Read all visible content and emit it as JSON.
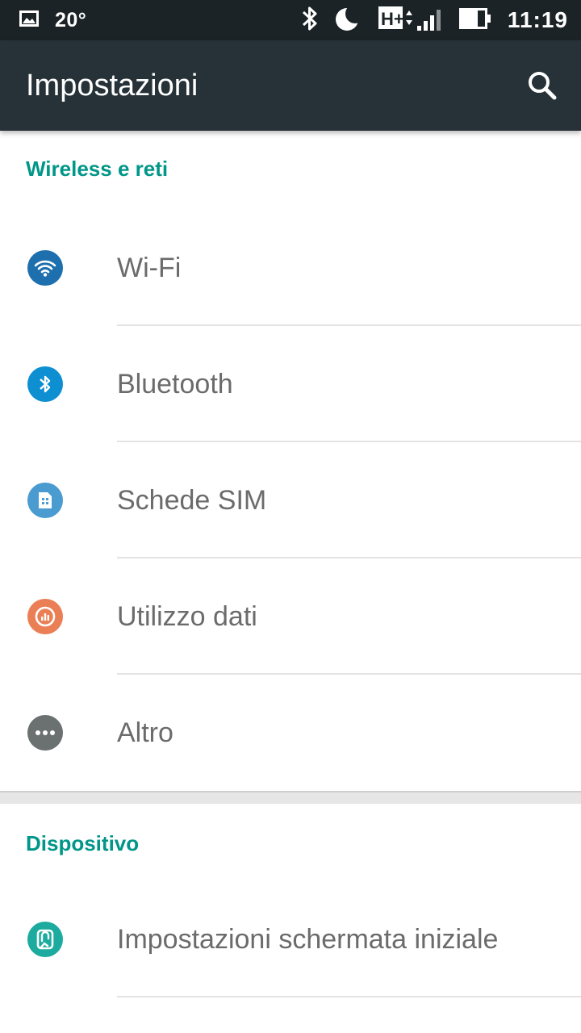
{
  "status_bar": {
    "temperature": "20°",
    "time": "11:19",
    "network_type": "H+",
    "icons": [
      "gallery-icon",
      "bluetooth-icon",
      "moon-icon",
      "network-type-icon",
      "signal-icon",
      "battery-icon"
    ]
  },
  "app_bar": {
    "title": "Impostazioni",
    "search_icon": "search-icon"
  },
  "sections": [
    {
      "header": "Wireless e reti",
      "items": [
        {
          "label": "Wi-Fi",
          "icon": "wifi-icon",
          "color": "#1e6fae"
        },
        {
          "label": "Bluetooth",
          "icon": "bluetooth-icon",
          "color": "#0d8fd1"
        },
        {
          "label": "Schede SIM",
          "icon": "sim-card-icon",
          "color": "#4a9bd0"
        },
        {
          "label": "Utilizzo dati",
          "icon": "data-usage-icon",
          "color": "#ea7f56"
        },
        {
          "label": "Altro",
          "icon": "more-icon",
          "color": "#6b7070"
        }
      ]
    },
    {
      "header": "Dispositivo",
      "items": [
        {
          "label": "Impostazioni schermata iniziale",
          "icon": "home-screen-icon",
          "color": "#1cab9e"
        }
      ]
    }
  ],
  "colors": {
    "status_bar_bg": "#1c2327",
    "app_bar_bg": "#263238",
    "accent": "#009688",
    "label_text": "#6b6b6b"
  }
}
